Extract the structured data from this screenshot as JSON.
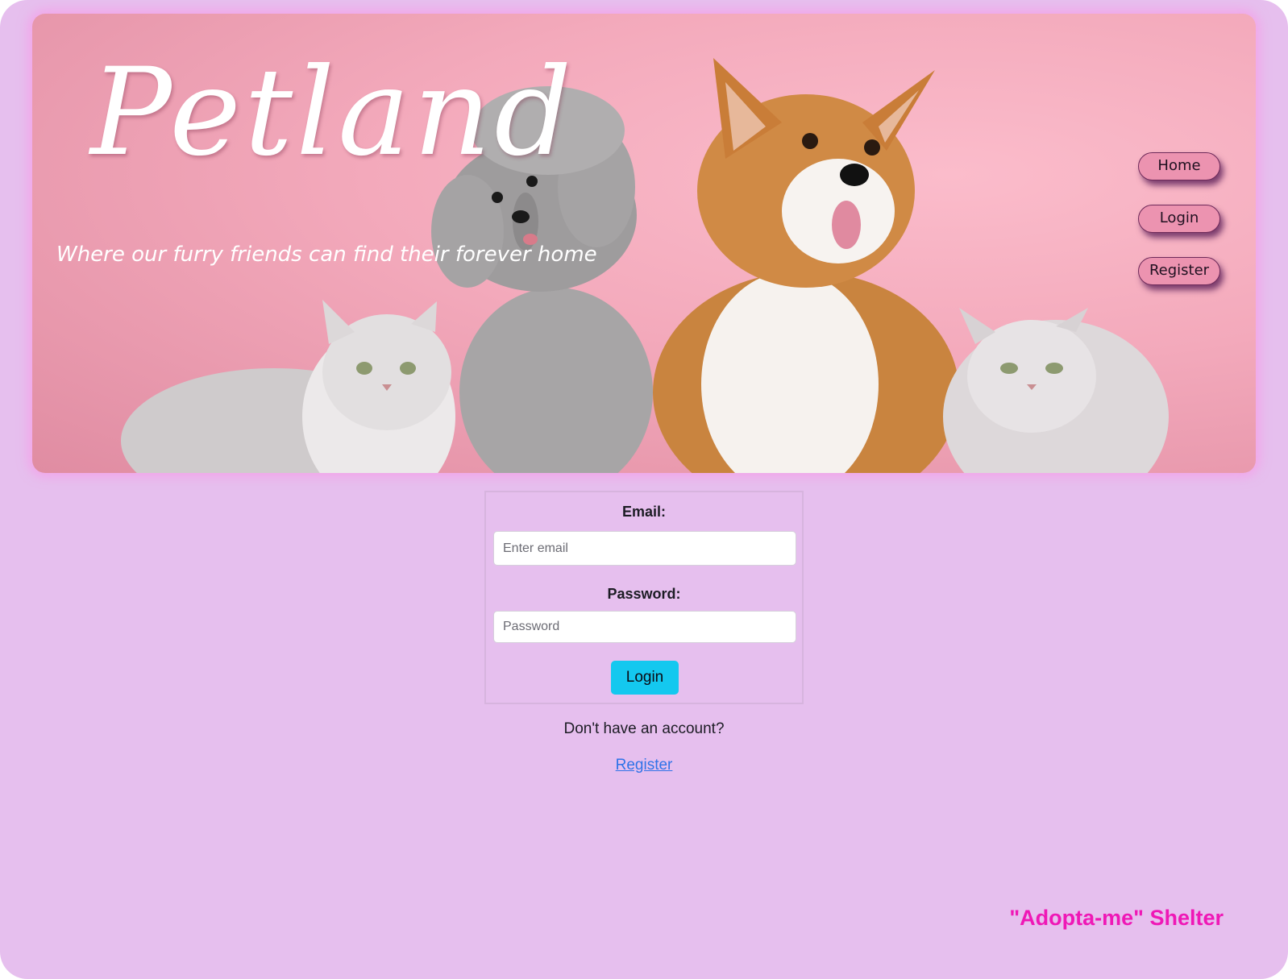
{
  "header": {
    "brand_title": "Petland",
    "tagline": "Where our furry friends can find their forever home",
    "hero_image": "pets-photo",
    "nav": [
      {
        "label": "Home"
      },
      {
        "label": "Login"
      },
      {
        "label": "Register"
      }
    ]
  },
  "login_form": {
    "email_label": "Email:",
    "email_placeholder": "Enter email",
    "email_value": "",
    "password_label": "Password:",
    "password_placeholder": "Password",
    "password_value": "",
    "submit_label": "Login"
  },
  "register_prompt": {
    "text": "Don't have an account?",
    "link_label": "Register"
  },
  "footer": {
    "shelter_name": "\"Adopta-me\" Shelter"
  },
  "colors": {
    "page_background": "#e6bfee",
    "hero_pink": "#f3a9bb",
    "nav_button": "#ec93b0",
    "login_button": "#14c8ef",
    "link": "#2f73e8",
    "footer_accent": "#ef18b6"
  }
}
